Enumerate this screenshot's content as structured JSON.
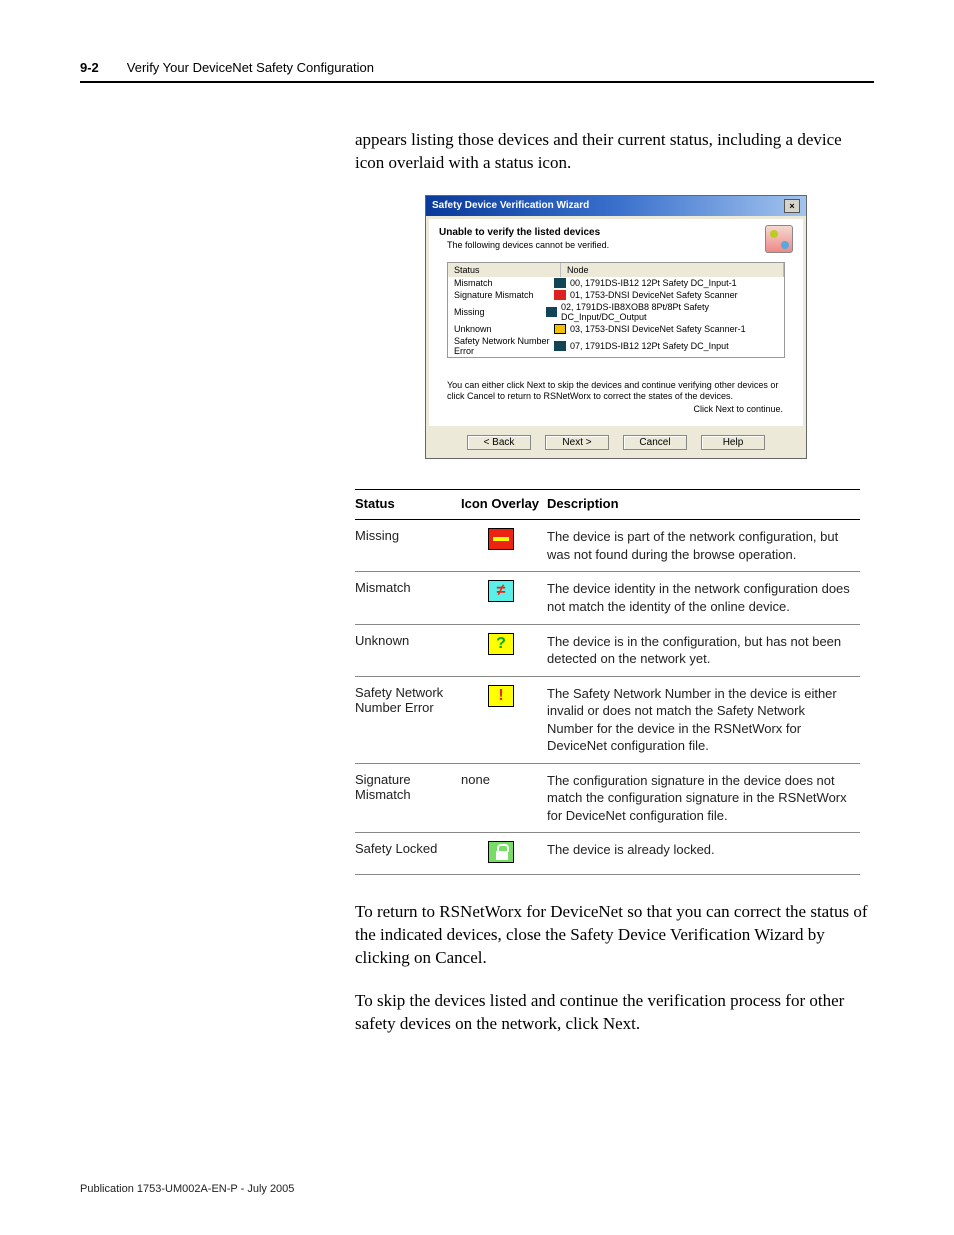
{
  "header": {
    "page_number": "9-2",
    "chapter_title": "Verify Your DeviceNet Safety Configuration"
  },
  "intro_para": "appears listing those devices and their current status, including a device icon overlaid with a status icon.",
  "dialog": {
    "title": "Safety Device Verification Wizard",
    "close_glyph": "×",
    "heading": "Unable to verify the listed devices",
    "subheading": "The following devices cannot be verified.",
    "columns": {
      "status": "Status",
      "node": "Node"
    },
    "rows": [
      {
        "status": "Mismatch",
        "icon": "drk",
        "node": "00, 1791DS-IB12 12Pt Safety DC_Input-1"
      },
      {
        "status": "Signature Mismatch",
        "icon": "red",
        "node": "01, 1753-DNSI DeviceNet Safety Scanner"
      },
      {
        "status": "Missing",
        "icon": "drk",
        "node": "02, 1791DS-IB8XOB8 8Pt/8Pt Safety DC_Input/DC_Output"
      },
      {
        "status": "Unknown",
        "icon": "yel",
        "node": "03, 1753-DNSI DeviceNet Safety Scanner-1"
      },
      {
        "status": "Safety Network Number Error",
        "icon": "drk",
        "node": "07, 1791DS-IB12 12Pt Safety DC_Input"
      }
    ],
    "footer_text": "You can either click Next to skip the devices and continue verifying other devices or click Cancel to return to RSNetWorx to correct the states of the devices.",
    "continue_text": "Click Next to continue.",
    "buttons": {
      "back": "< Back",
      "next": "Next >",
      "cancel": "Cancel",
      "help": "Help"
    }
  },
  "status_table": {
    "headers": {
      "status": "Status",
      "icon": "Icon Overlay",
      "description": "Description"
    },
    "rows": [
      {
        "status": "Missing",
        "icon_key": "missing",
        "icon_text": "",
        "description": "The device is part of the network configuration, but was not found during the browse operation."
      },
      {
        "status": "Mismatch",
        "icon_key": "mismatch",
        "icon_text": "≠",
        "description": "The device identity in the network configuration does not match the identity of the online device."
      },
      {
        "status": "Unknown",
        "icon_key": "unknown",
        "icon_text": "?",
        "description": "The device is in the configuration, but has not been detected on the network yet."
      },
      {
        "status": "Safety Network Number Error",
        "icon_key": "neterr",
        "icon_text": "!",
        "description": "The Safety Network Number in the device is either invalid or does not match the Safety Network Number for the device in the RSNetWorx for DeviceNet configuration file."
      },
      {
        "status": "Signature Mismatch",
        "icon_key": "none",
        "icon_text": "none",
        "description": "The configuration signature in the device does not match the configuration signature in the RSNetWorx for DeviceNet configuration file."
      },
      {
        "status": "Safety Locked",
        "icon_key": "locked",
        "icon_text": "",
        "description": "The device is already locked."
      }
    ]
  },
  "after_para_1": "To return to RSNetWorx for DeviceNet so that you can correct the status of the indicated devices, close the Safety Device Verification Wizard by clicking on Cancel.",
  "after_para_2": "To skip the devices listed and continue the verification process for other safety devices on the network, click Next.",
  "publication": "Publication 1753-UM002A-EN-P - July 2005"
}
